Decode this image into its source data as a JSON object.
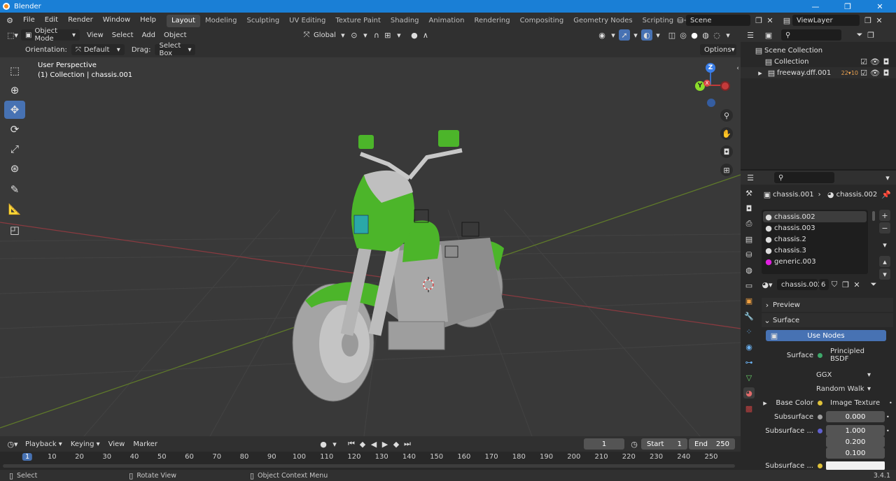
{
  "window": {
    "title": "Blender",
    "minimize": "—",
    "maximize": "❐",
    "close": "✕"
  },
  "menus": [
    "File",
    "Edit",
    "Render",
    "Window",
    "Help"
  ],
  "workspaces": [
    "Layout",
    "Modeling",
    "Sculpting",
    "UV Editing",
    "Texture Paint",
    "Shading",
    "Animation",
    "Rendering",
    "Compositing",
    "Geometry Nodes",
    "Scripting",
    "+"
  ],
  "scene": {
    "name": "Scene",
    "view_layer": "ViewLayer"
  },
  "viewport_header": {
    "mode": "Object Mode",
    "menus": [
      "View",
      "Select",
      "Add",
      "Object"
    ],
    "transform": "Global",
    "orientation_label": "Orientation:",
    "orientation_value": "Default",
    "drag_label": "Drag:",
    "drag_value": "Select Box",
    "options": "Options"
  },
  "viewport": {
    "perspective": "User Perspective",
    "collection_info": "(1) Collection | chassis.001"
  },
  "gizmo": {
    "z": "Z",
    "y": "Y",
    "x": "X"
  },
  "outliner": {
    "items": [
      {
        "label": "Scene Collection"
      },
      {
        "label": "Collection"
      },
      {
        "label": "freeway.dff.001",
        "badge": "22",
        "badge2": "10"
      }
    ]
  },
  "properties": {
    "breadcrumb_object": "chassis.001",
    "breadcrumb_material": "chassis.002",
    "material_slots": [
      "chassis.002",
      "chassis.003",
      "chassis.2",
      "chassis.3",
      "generic.003"
    ],
    "active_material": "chassis.002",
    "users": "6",
    "panels": {
      "preview": "Preview",
      "surface": "Surface"
    },
    "use_nodes": "Use Nodes",
    "surface_label": "Surface",
    "surface_value": "Principled BSDF",
    "distribution": "GGX",
    "subsurface_method": "Random Walk",
    "base_color_label": "Base Color",
    "base_color_value": "Image Texture",
    "subsurface_label": "Subsurface",
    "subsurface_value": "0.000",
    "subsurface_radius_label": "Subsurface ...",
    "subsurface_radius": [
      "1.000",
      "0.200",
      "0.100"
    ],
    "subsurface_color_label": "Subsurface ..."
  },
  "timeline": {
    "menus": [
      "Playback",
      "Keying",
      "View",
      "Marker"
    ],
    "current_frame": "1",
    "start_label": "Start",
    "start": "1",
    "end_label": "End",
    "end": "250",
    "ticks": [
      "1",
      "10",
      "20",
      "30",
      "40",
      "50",
      "60",
      "70",
      "80",
      "90",
      "100",
      "110",
      "120",
      "130",
      "140",
      "150",
      "160",
      "170",
      "180",
      "190",
      "200",
      "210",
      "220",
      "230",
      "240",
      "250"
    ]
  },
  "status": {
    "select": "Select",
    "rotate": "Rotate View",
    "context": "Object Context Menu",
    "version": "3.4.1"
  },
  "colors": {
    "accent": "#4772b3",
    "titlebar": "#1a7fd6",
    "bike_green": "#4cb52a"
  }
}
